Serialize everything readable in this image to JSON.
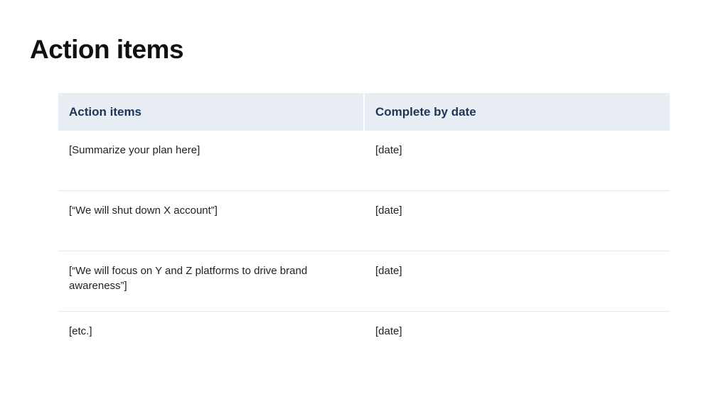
{
  "title": "Action items",
  "table": {
    "headers": [
      "Action items",
      "Complete by date"
    ],
    "rows": [
      {
        "item": "[Summarize your plan here]",
        "date": "[date]"
      },
      {
        "item": "[“We will shut down X account”]",
        "date": "[date]"
      },
      {
        "item": "[“We will focus on Y and Z platforms to drive brand awareness”]",
        "date": "[date]"
      },
      {
        "item": "[etc.]",
        "date": "[date]"
      }
    ]
  },
  "colors": {
    "header_background": "#e8eef4",
    "header_text": "#1d3557",
    "row_divider": "#e6e6e6"
  }
}
